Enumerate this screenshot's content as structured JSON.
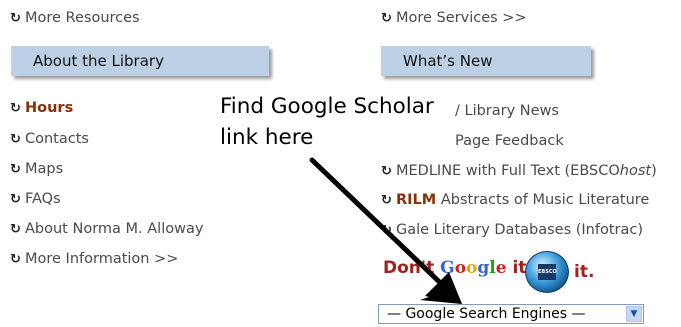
{
  "left_top_link": "More Resources",
  "right_top_link": "More Services >>",
  "about_header": "About the Library",
  "whatsnew_header": "What’s New",
  "left_links": [
    {
      "label": "Hours",
      "bold": true
    },
    {
      "label": "Contacts"
    },
    {
      "label": "Maps"
    },
    {
      "label": "FAQs"
    },
    {
      "label": "About Norma M. Alloway"
    },
    {
      "label": "More Information >>"
    }
  ],
  "right_links": {
    "library_news": "/ Library News",
    "page_feedback": "Page Feedback",
    "medline_prefix": "MEDLINE with Full Text (EBSCO",
    "medline_italic": "host",
    "medline_suffix": ")",
    "rilm_bold": "RILM",
    "rilm_rest": " Abstracts of Music Literature",
    "gale": "Gale Literary Databases (Infotrac)"
  },
  "annotation": {
    "line1": "Find Google Scholar",
    "line2": "link here"
  },
  "promo": {
    "dont": "Don't",
    "google": [
      "G",
      "o",
      "o",
      "g",
      "l",
      "e"
    ],
    "it1": "it.",
    "ebsco_label": "EBSCO",
    "it2": "it."
  },
  "select": {
    "value": "— Google Search Engines —"
  },
  "icons": {
    "bullet": "bullet-arrow-icon",
    "dropdown": "chevron-down-icon"
  }
}
